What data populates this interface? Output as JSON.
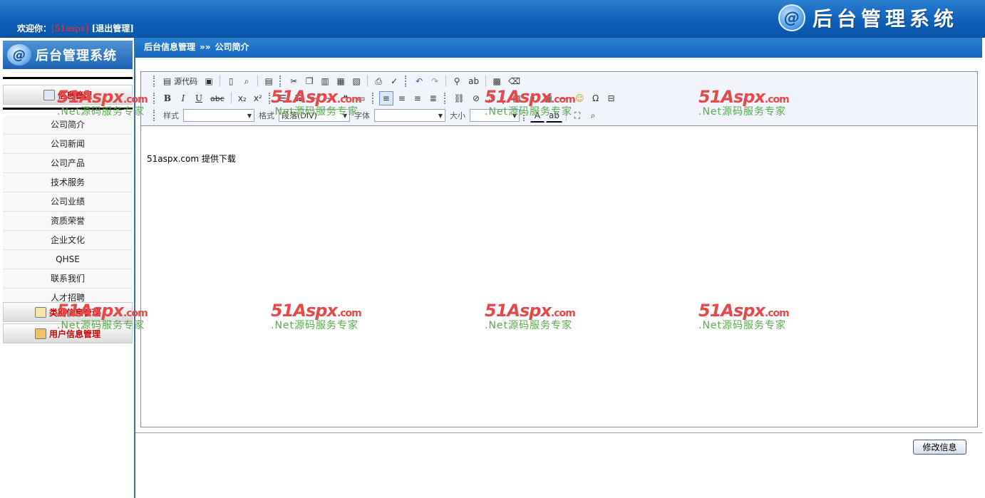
{
  "header": {
    "welcome_label": "欢迎你：",
    "username": "[51aspx]",
    "logout_label": "[退出管理]",
    "brand_icon": "@",
    "brand_title": "后台管理系统"
  },
  "sidebar": {
    "logo_title": "后台管理系统",
    "sections": [
      {
        "label": "信息管理",
        "icon": "document-icon"
      },
      {
        "label": "类别信息管理",
        "icon": "edit-icon"
      },
      {
        "label": "用户信息管理",
        "icon": "user-icon"
      }
    ],
    "items": [
      {
        "label": "公司简介"
      },
      {
        "label": "公司新闻"
      },
      {
        "label": "公司产品"
      },
      {
        "label": "技术服务"
      },
      {
        "label": "公司业绩"
      },
      {
        "label": "资质荣誉"
      },
      {
        "label": "企业文化"
      },
      {
        "label": "QHSE"
      },
      {
        "label": "联系我们"
      },
      {
        "label": "人才招聘"
      }
    ]
  },
  "breadcrumb": {
    "root": "后台信息管理",
    "separator": "»»",
    "current": "公司简介"
  },
  "editor": {
    "source_label": "源代码",
    "style_label": "样式",
    "format_label": "格式",
    "format_value": "段落(DIV)",
    "font_label": "字体",
    "size_label": "大小",
    "content_text": "51aspx.com 提供下载"
  },
  "actions": {
    "submit_label": "修改信息"
  },
  "watermark": {
    "brand": "51Aspx",
    "suffix": ".com",
    "tagline": ".Net源码服务专家"
  },
  "colors": {
    "header_blue": "#1566bf",
    "accent_red": "#cc0000",
    "watermark_red": "#e34a4a",
    "watermark_green": "#5aa94e"
  }
}
